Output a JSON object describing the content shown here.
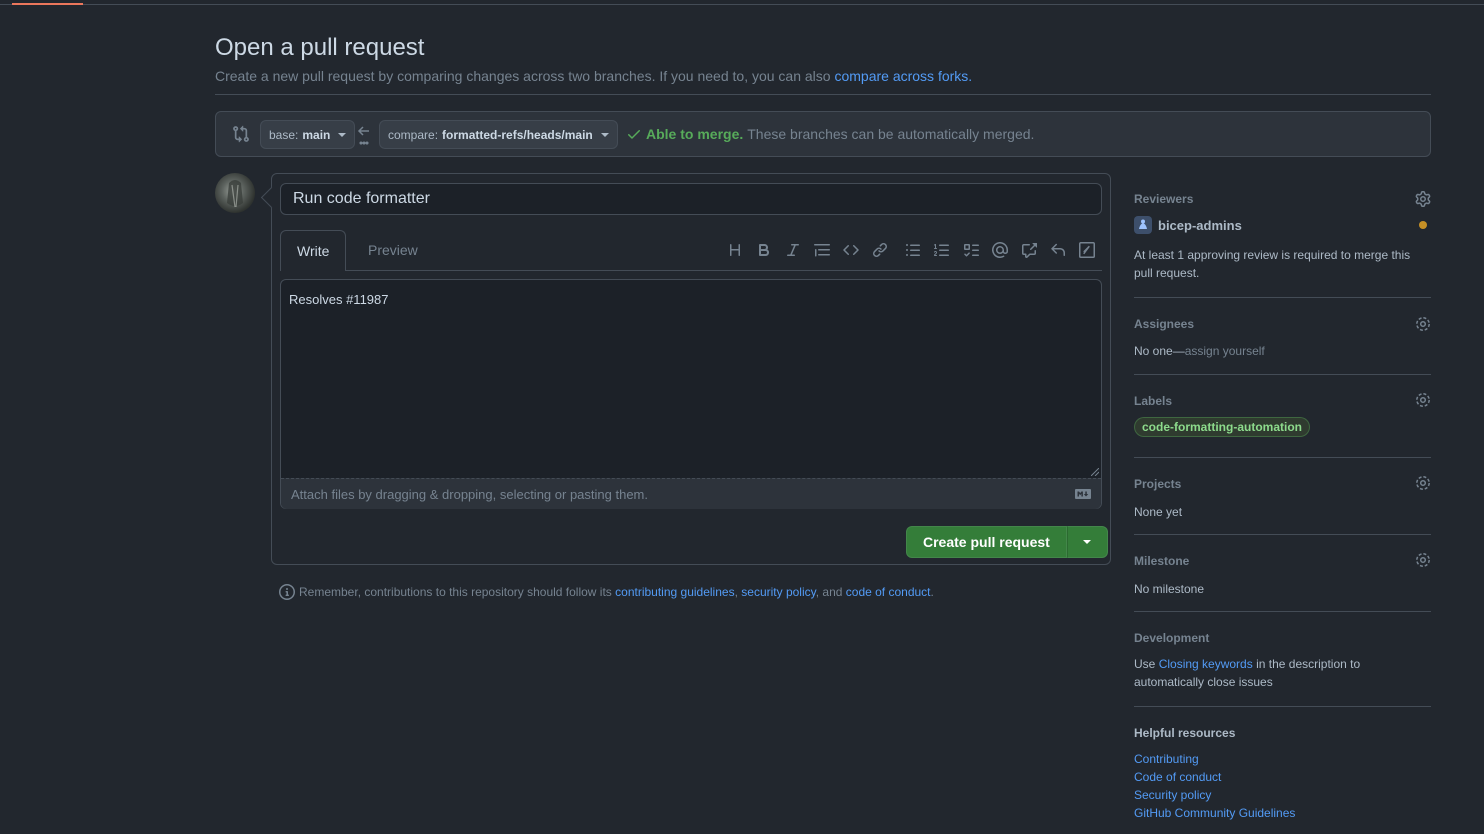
{
  "page": {
    "title": "Open a pull request",
    "subtitle": "Create a new pull request by comparing changes across two branches. If you need to, you can also",
    "subtitle_link": "compare across forks."
  },
  "range": {
    "base_prefix": "base:",
    "base_branch": "main",
    "compare_prefix": "compare:",
    "compare_branch": "formatted-refs/heads/main",
    "merge_ok": "Able to merge.",
    "merge_text": "These branches can be automatically merged."
  },
  "form": {
    "title_value": "Run code formatter",
    "title_placeholder": "Title",
    "tabs": [
      {
        "label": "Write"
      },
      {
        "label": "Preview"
      }
    ],
    "body_text": "Resolves #11987",
    "attach_text": "Attach files by dragging & dropping, selecting or pasting them.",
    "create_button": "Create pull request"
  },
  "reminder": {
    "prefix": "Remember, contributions to this repository should follow its",
    "link1": "contributing guidelines",
    "sep1": ",",
    "link2": "security policy",
    "sep2": ", and",
    "link3": "code of conduct",
    "end": "."
  },
  "sidebar": {
    "reviewers": {
      "heading": "Reviewers",
      "name": "bicep-admins",
      "note": "At least 1 approving review is required to merge this pull request."
    },
    "assignees": {
      "heading": "Assignees",
      "none": "No one—",
      "assign_link": "assign yourself"
    },
    "labels": {
      "heading": "Labels",
      "label": "code-formatting-automation"
    },
    "projects": {
      "heading": "Projects",
      "value": "None yet"
    },
    "milestone": {
      "heading": "Milestone",
      "value": "No milestone"
    },
    "development": {
      "heading": "Development",
      "pre": "Use",
      "link": "Closing keywords",
      "post": "in the description to automatically close issues"
    },
    "helpful": {
      "heading": "Helpful resources",
      "links": [
        "Contributing",
        "Code of conduct",
        "Security policy",
        "GitHub Community Guidelines"
      ]
    }
  },
  "colors": {
    "background": "#22272e",
    "accent_link": "#539bf5",
    "success": "#57ab5a",
    "button_green": "#347d39"
  }
}
